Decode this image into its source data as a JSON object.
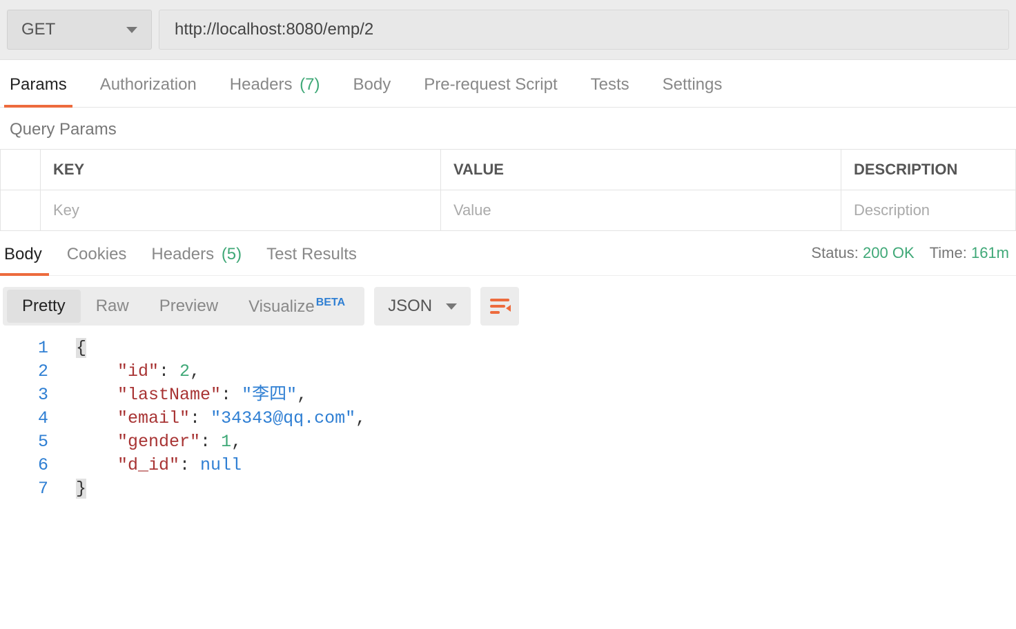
{
  "request": {
    "method": "GET",
    "url": "http://localhost:8080/emp/2"
  },
  "requestTabs": {
    "params": "Params",
    "authorization": "Authorization",
    "headers": "Headers",
    "headersCount": "(7)",
    "body": "Body",
    "prerequest": "Pre-request Script",
    "tests": "Tests",
    "settings": "Settings"
  },
  "queryParams": {
    "title": "Query Params",
    "headerKey": "KEY",
    "headerValue": "VALUE",
    "headerDesc": "DESCRIPTION",
    "placeholderKey": "Key",
    "placeholderValue": "Value",
    "placeholderDesc": "Description"
  },
  "responseTabs": {
    "body": "Body",
    "cookies": "Cookies",
    "headers": "Headers",
    "headersCount": "(5)",
    "testResults": "Test Results"
  },
  "responseMeta": {
    "statusLabel": "Status:",
    "statusValue": "200 OK",
    "timeLabel": "Time:",
    "timeValue": "161m"
  },
  "viewTabs": {
    "pretty": "Pretty",
    "raw": "Raw",
    "preview": "Preview",
    "visualize": "Visualize",
    "beta": "BETA"
  },
  "formatSelect": "JSON",
  "responseBody": {
    "lines": [
      "1",
      "2",
      "3",
      "4",
      "5",
      "6",
      "7"
    ],
    "json": {
      "id": 2,
      "lastName": "李四",
      "email": "34343@qq.com",
      "gender": 1,
      "d_id": null
    }
  }
}
